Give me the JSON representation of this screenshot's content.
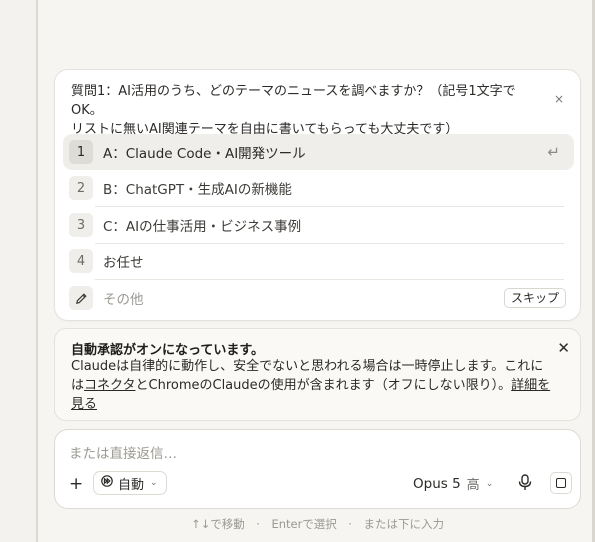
{
  "question": {
    "text_line1": "質問1：AI活用のうち、どのテーマのニュースを調べますか？（記号1文字でOK。",
    "text_line2": "リストに無いAI関連テーマを自由に書いてもらっても大丈夫です）",
    "close_symbol": "×",
    "options": [
      {
        "number": "1",
        "label": "A：Claude Code・AI開発ツール"
      },
      {
        "number": "2",
        "label": "B：ChatGPT・生成AIの新機能"
      },
      {
        "number": "3",
        "label": "C：AIの仕事活用・ビジネス事例"
      },
      {
        "number": "4",
        "label": "お任せ"
      }
    ],
    "other_placeholder": "その他",
    "skip_label": "スキップ",
    "enter_symbol": "↵"
  },
  "notice": {
    "title": "自動承認がオンになっています。",
    "body_part1": "Claudeは自律的に動作し、安全でないと思われる場合は一時停止します。これには",
    "link_connector": "コネクタ",
    "body_part2": "とChromeのClaudeの使用が含まれます（オフにしない限り）。",
    "link_details_1": "詳細を",
    "link_details_2": "見る",
    "close_symbol": "✕"
  },
  "composer": {
    "placeholder": "または直接返信…",
    "mode_label": "自動",
    "model_label": "Opus 5",
    "effort_label": "高"
  },
  "hint": "↑↓で移動　·　Enterで選択　·　または下に入力"
}
